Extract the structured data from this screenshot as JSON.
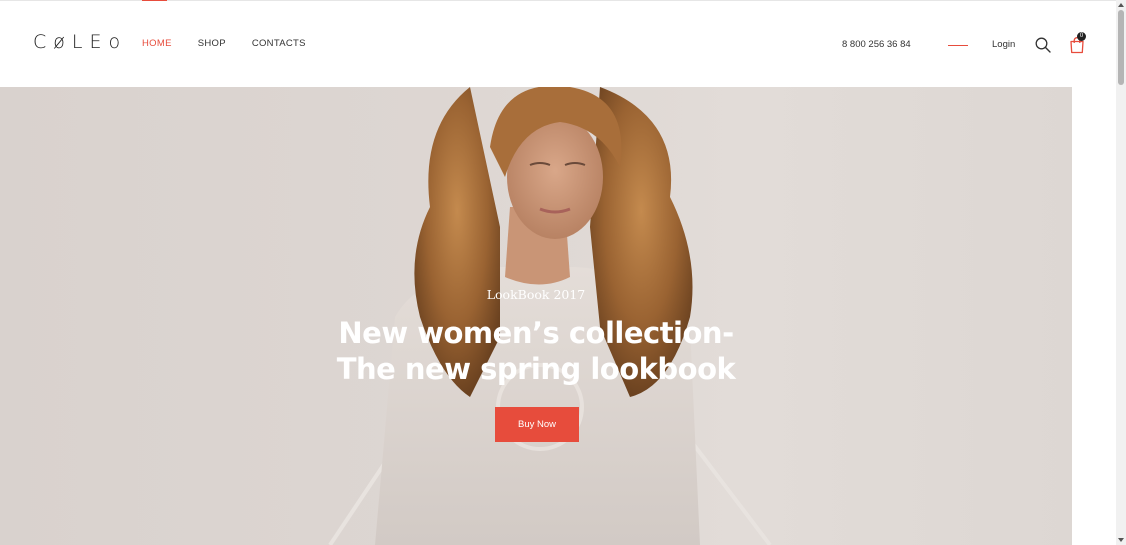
{
  "header": {
    "logo": "CøLEo",
    "nav": [
      {
        "label": "HOME",
        "active": true
      },
      {
        "label": "SHOP",
        "active": false
      },
      {
        "label": "CONTACTS",
        "active": false
      }
    ],
    "phone": "8 800 256 36 84",
    "login_label": "Login",
    "cart_count": "0",
    "icons": {
      "search": "search-icon",
      "cart": "shopping-bag-icon"
    }
  },
  "hero": {
    "eyebrow": "LookBook 2017",
    "title_line1": "New women’s collection-",
    "title_line2": "The new spring lookbook",
    "button_label": "Buy Now"
  },
  "colors": {
    "accent": "#e74c3c",
    "hero_bg": "#ddd6d2",
    "text": "#333333"
  }
}
